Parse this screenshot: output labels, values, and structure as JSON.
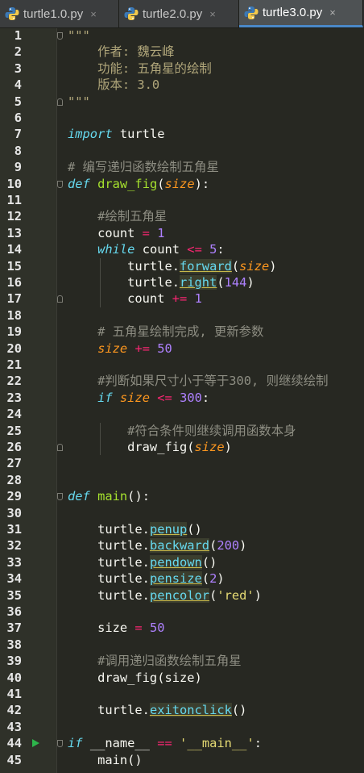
{
  "tabs": [
    {
      "label": "turtle1.0.py",
      "active": false,
      "close": "×"
    },
    {
      "label": "turtle2.0.py",
      "active": false,
      "close": "×"
    },
    {
      "label": "turtle3.0.py",
      "active": true,
      "close": "×"
    }
  ],
  "colors": {
    "background": "#272822",
    "keyword": "#66d9ef",
    "function": "#a6e22e",
    "parameter": "#fd971f",
    "number": "#ae81ff",
    "operator": "#f92672",
    "string": "#e6db74",
    "comment": "#8d8d82",
    "tab_accent": "#4a88c7"
  },
  "line_numbers": [
    "1",
    "2",
    "3",
    "4",
    "5",
    "6",
    "7",
    "8",
    "9",
    "10",
    "11",
    "12",
    "13",
    "14",
    "15",
    "16",
    "17",
    "18",
    "19",
    "20",
    "21",
    "22",
    "23",
    "24",
    "25",
    "26",
    "27",
    "28",
    "29",
    "30",
    "31",
    "32",
    "33",
    "34",
    "35",
    "36",
    "37",
    "38",
    "39",
    "40",
    "41",
    "42",
    "43",
    "44",
    "45"
  ],
  "code": [
    [
      {
        "t": "\"\"\"",
        "c": "doc"
      }
    ],
    [
      {
        "t": "    作者: 魏云峰",
        "c": "doc"
      }
    ],
    [
      {
        "t": "    功能: 五角星的绘制",
        "c": "doc"
      }
    ],
    [
      {
        "t": "    版本: 3.0",
        "c": "doc"
      }
    ],
    [
      {
        "t": "\"\"\"",
        "c": "doc"
      }
    ],
    [],
    [
      {
        "t": "import",
        "c": "kw"
      },
      {
        "t": " turtle",
        "c": "pl"
      }
    ],
    [],
    [
      {
        "t": "# 编写递归函数绘制五角星",
        "c": "cm"
      }
    ],
    [
      {
        "t": "def",
        "c": "kw"
      },
      {
        "t": " ",
        "c": "pl"
      },
      {
        "t": "draw_fig",
        "c": "fn"
      },
      {
        "t": "(",
        "c": "pl"
      },
      {
        "t": "size",
        "c": "par"
      },
      {
        "t": "):",
        "c": "pl"
      }
    ],
    [],
    [
      {
        "t": "    #绘制五角星",
        "c": "cm"
      }
    ],
    [
      {
        "t": "    count ",
        "c": "pl"
      },
      {
        "t": "=",
        "c": "op"
      },
      {
        "t": " ",
        "c": "pl"
      },
      {
        "t": "1",
        "c": "num"
      }
    ],
    [
      {
        "t": "    ",
        "c": "pl"
      },
      {
        "t": "while",
        "c": "kw"
      },
      {
        "t": " count ",
        "c": "pl"
      },
      {
        "t": "<=",
        "c": "op"
      },
      {
        "t": " ",
        "c": "pl"
      },
      {
        "t": "5",
        "c": "num"
      },
      {
        "t": ":",
        "c": "pl"
      }
    ],
    [
      {
        "t": "        turtle.",
        "c": "pl"
      },
      {
        "t": "forward",
        "c": "meth"
      },
      {
        "t": "(",
        "c": "pl"
      },
      {
        "t": "size",
        "c": "par"
      },
      {
        "t": ")",
        "c": "pl"
      }
    ],
    [
      {
        "t": "        turtle.",
        "c": "pl"
      },
      {
        "t": "right",
        "c": "meth"
      },
      {
        "t": "(",
        "c": "pl"
      },
      {
        "t": "144",
        "c": "num"
      },
      {
        "t": ")",
        "c": "pl"
      }
    ],
    [
      {
        "t": "        count ",
        "c": "pl"
      },
      {
        "t": "+=",
        "c": "op"
      },
      {
        "t": " ",
        "c": "pl"
      },
      {
        "t": "1",
        "c": "num"
      }
    ],
    [],
    [
      {
        "t": "    # 五角星绘制完成, 更新参数",
        "c": "cm"
      }
    ],
    [
      {
        "t": "    ",
        "c": "pl"
      },
      {
        "t": "size",
        "c": "par"
      },
      {
        "t": " ",
        "c": "pl"
      },
      {
        "t": "+=",
        "c": "op"
      },
      {
        "t": " ",
        "c": "pl"
      },
      {
        "t": "50",
        "c": "num"
      }
    ],
    [],
    [
      {
        "t": "    #判断如果尺寸小于等于300, 则继续绘制",
        "c": "cm"
      }
    ],
    [
      {
        "t": "    ",
        "c": "pl"
      },
      {
        "t": "if",
        "c": "kw"
      },
      {
        "t": " ",
        "c": "pl"
      },
      {
        "t": "size",
        "c": "par"
      },
      {
        "t": " ",
        "c": "pl"
      },
      {
        "t": "<=",
        "c": "op"
      },
      {
        "t": " ",
        "c": "pl"
      },
      {
        "t": "300",
        "c": "num"
      },
      {
        "t": ":",
        "c": "pl"
      }
    ],
    [],
    [
      {
        "t": "        #符合条件则继续调用函数本身",
        "c": "cm"
      }
    ],
    [
      {
        "t": "        draw_fig(",
        "c": "pl"
      },
      {
        "t": "size",
        "c": "par"
      },
      {
        "t": ")",
        "c": "pl"
      }
    ],
    [],
    [],
    [
      {
        "t": "def",
        "c": "kw"
      },
      {
        "t": " ",
        "c": "pl"
      },
      {
        "t": "main",
        "c": "fn"
      },
      {
        "t": "():",
        "c": "pl"
      }
    ],
    [],
    [
      {
        "t": "    turtle.",
        "c": "pl"
      },
      {
        "t": "penup",
        "c": "meth"
      },
      {
        "t": "()",
        "c": "pl"
      }
    ],
    [
      {
        "t": "    turtle.",
        "c": "pl"
      },
      {
        "t": "backward",
        "c": "meth"
      },
      {
        "t": "(",
        "c": "pl"
      },
      {
        "t": "200",
        "c": "num"
      },
      {
        "t": ")",
        "c": "pl"
      }
    ],
    [
      {
        "t": "    turtle.",
        "c": "pl"
      },
      {
        "t": "pendown",
        "c": "meth"
      },
      {
        "t": "()",
        "c": "pl"
      }
    ],
    [
      {
        "t": "    turtle.",
        "c": "pl"
      },
      {
        "t": "pensize",
        "c": "meth"
      },
      {
        "t": "(",
        "c": "pl"
      },
      {
        "t": "2",
        "c": "num"
      },
      {
        "t": ")",
        "c": "pl"
      }
    ],
    [
      {
        "t": "    turtle.",
        "c": "pl"
      },
      {
        "t": "pencolor",
        "c": "meth"
      },
      {
        "t": "(",
        "c": "pl"
      },
      {
        "t": "'red'",
        "c": "str"
      },
      {
        "t": ")",
        "c": "pl"
      }
    ],
    [],
    [
      {
        "t": "    size ",
        "c": "pl"
      },
      {
        "t": "=",
        "c": "op"
      },
      {
        "t": " ",
        "c": "pl"
      },
      {
        "t": "50",
        "c": "num"
      }
    ],
    [],
    [
      {
        "t": "    #调用递归函数绘制五角星",
        "c": "cm"
      }
    ],
    [
      {
        "t": "    draw_fig(size)",
        "c": "pl"
      }
    ],
    [],
    [
      {
        "t": "    turtle.",
        "c": "pl"
      },
      {
        "t": "exitonclick",
        "c": "meth"
      },
      {
        "t": "()",
        "c": "pl"
      }
    ],
    [],
    [
      {
        "t": "if",
        "c": "kw"
      },
      {
        "t": " __name__ ",
        "c": "pl"
      },
      {
        "t": "==",
        "c": "op"
      },
      {
        "t": " ",
        "c": "pl"
      },
      {
        "t": "'__main__'",
        "c": "str"
      },
      {
        "t": ":",
        "c": "pl"
      }
    ],
    [
      {
        "t": "    main()",
        "c": "pl"
      }
    ]
  ],
  "fold_markers": [
    {
      "line": 1,
      "dir": "down"
    },
    {
      "line": 5,
      "dir": "up"
    },
    {
      "line": 10,
      "dir": "down"
    },
    {
      "line": 17,
      "dir": "up"
    },
    {
      "line": 26,
      "dir": "up"
    },
    {
      "line": 29,
      "dir": "down"
    },
    {
      "line": 44,
      "dir": "down"
    }
  ],
  "run_marker_line": 44
}
